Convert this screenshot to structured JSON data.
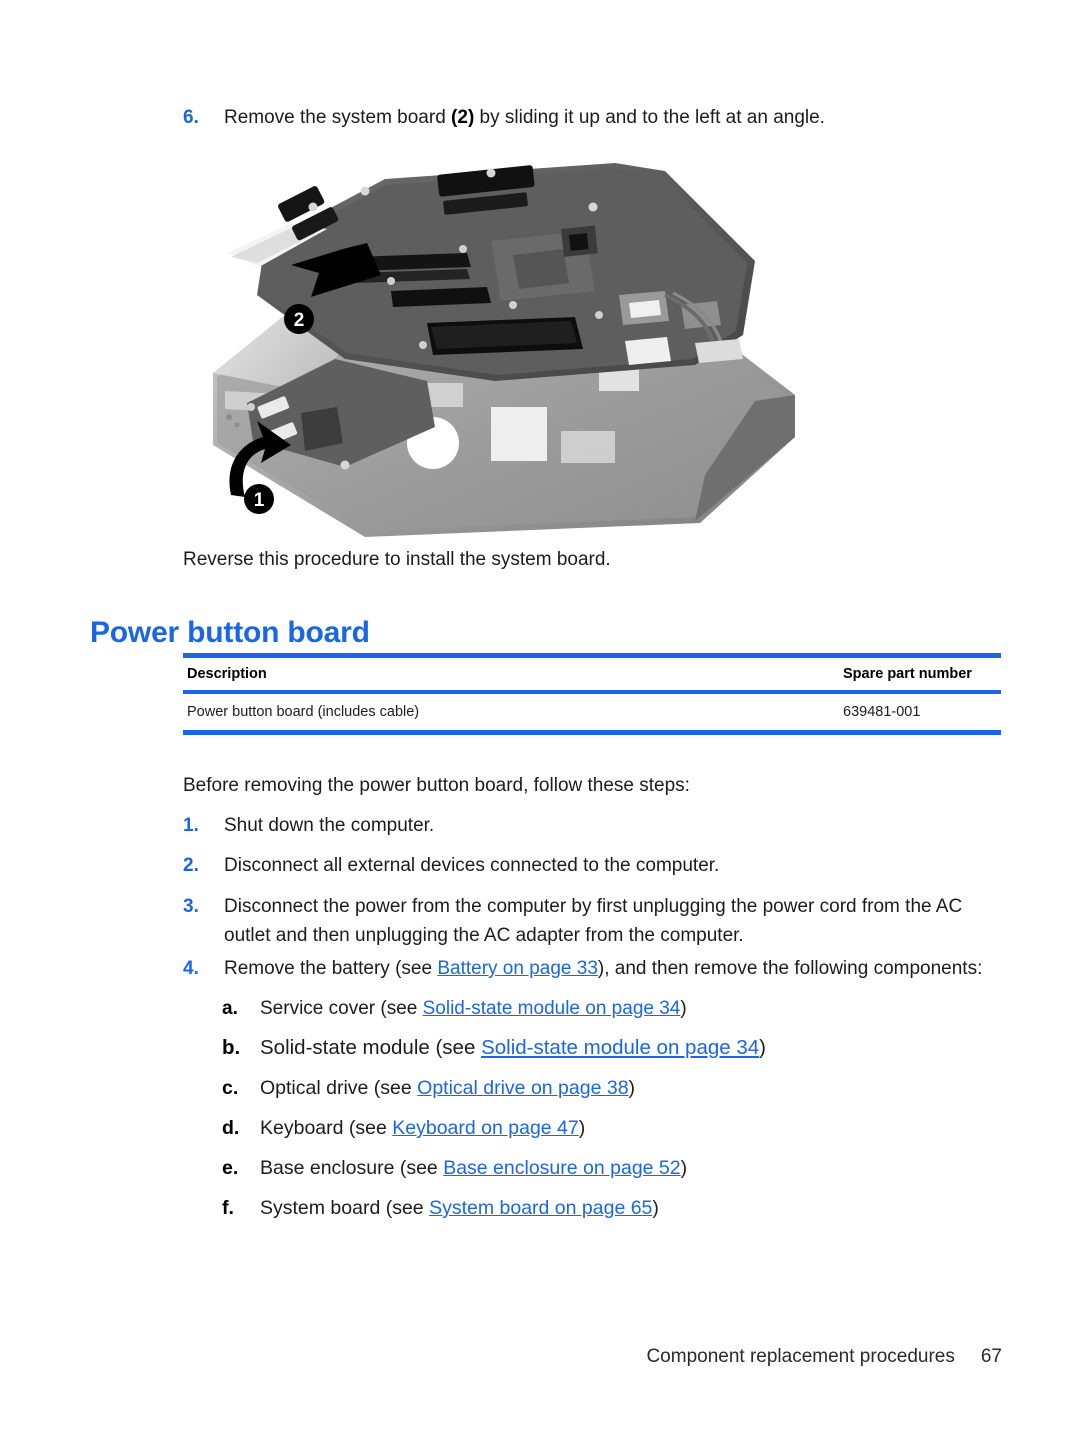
{
  "step6": {
    "marker": "6.",
    "text_before": "Remove the system board ",
    "bold_ref": "(2)",
    "text_after": " by sliding it up and to the left at an angle."
  },
  "figure": {
    "alt": "Exploded view of laptop system board being lifted out of the base enclosure",
    "callouts": [
      {
        "label": "1",
        "meaning": "lift-front-edge-arrow"
      },
      {
        "label": "2",
        "meaning": "slide-up-and-left-arrow"
      }
    ]
  },
  "reverse_note": "Reverse this procedure to install the system board.",
  "heading": "Power button board",
  "parts_table": {
    "columns": [
      "Description",
      "Spare part number"
    ],
    "rows": [
      {
        "description": "Power button board (includes cable)",
        "spare_part_number": "639481-001"
      }
    ]
  },
  "intro": "Before removing the power button board, follow these steps:",
  "steps": [
    {
      "marker": "1.",
      "text": "Shut down the computer."
    },
    {
      "marker": "2.",
      "text": "Disconnect all external devices connected to the computer."
    },
    {
      "marker": "3.",
      "text": "Disconnect the power from the computer by first unplugging the power cord from the AC outlet and then unplugging the AC adapter from the computer."
    },
    {
      "marker": "4.",
      "text_before": "Remove the battery (see ",
      "link": "Battery on page 33",
      "text_after": "), and then remove the following components:"
    }
  ],
  "subitems": [
    {
      "marker": "a.",
      "text_before": "Service cover (see ",
      "link": "Solid-state module on page 34",
      "text_after": ")"
    },
    {
      "marker": "b.",
      "text_before": "Solid-state module (see ",
      "link": "Solid-state module on page 34",
      "text_after": ")"
    },
    {
      "marker": "c.",
      "text_before": "Optical drive (see ",
      "link": "Optical drive on page 38",
      "text_after": ")"
    },
    {
      "marker": "d.",
      "text_before": "Keyboard (see ",
      "link": "Keyboard on page 47",
      "text_after": ")"
    },
    {
      "marker": "e.",
      "text_before": "Base enclosure (see ",
      "link": "Base enclosure on page 52",
      "text_after": ")"
    },
    {
      "marker": "f.",
      "text_before": "System board (see ",
      "link": "System board on page 65",
      "text_after": ")"
    }
  ],
  "footer": {
    "chapter": "Component replacement procedures",
    "page_number": "67"
  },
  "colors": {
    "accent_blue": "#1a66e8",
    "body_text": "#1c1c1c"
  }
}
